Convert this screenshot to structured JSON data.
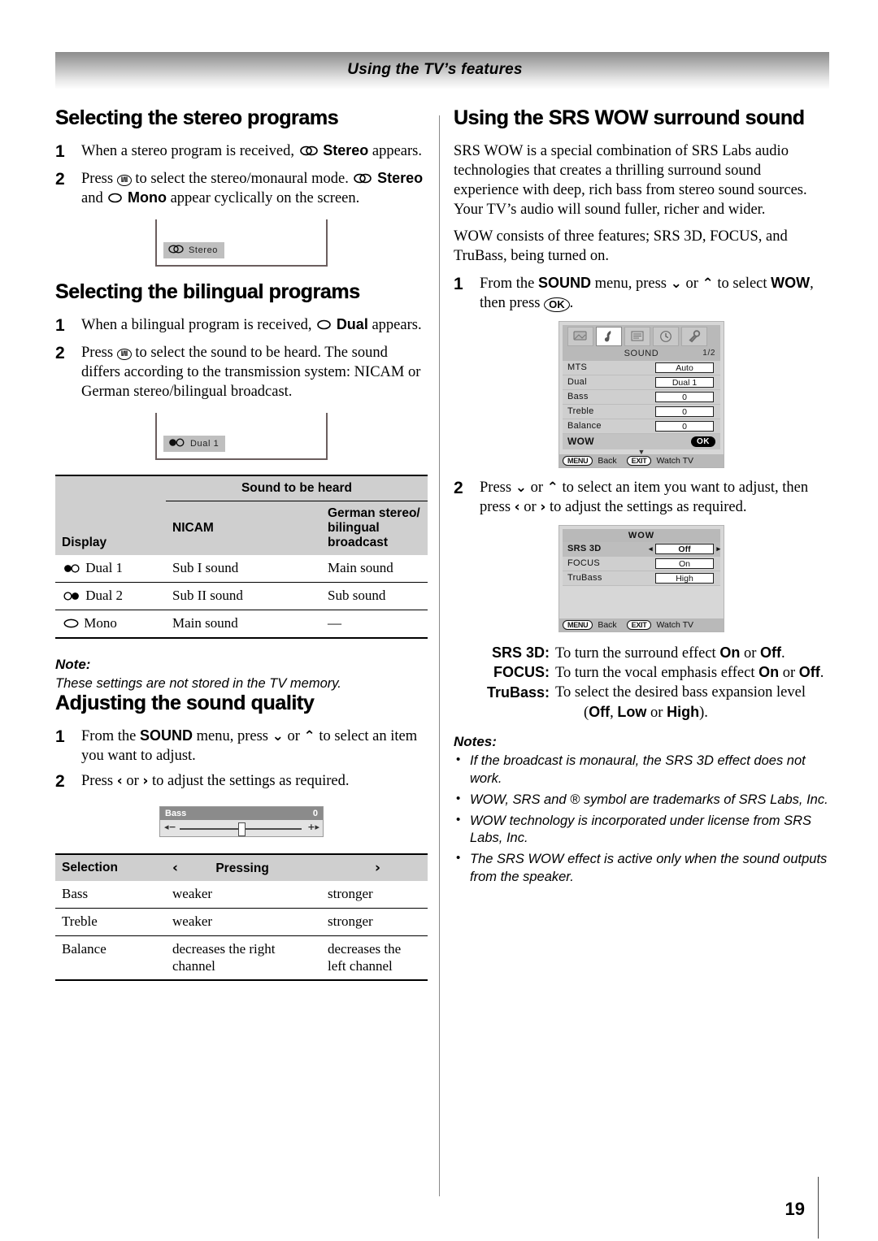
{
  "header": {
    "title": "Using the TV’s features"
  },
  "footer": {
    "page_number": "19"
  },
  "left": {
    "sections": {
      "stereo": {
        "heading": "Selecting the stereo programs",
        "steps": [
          {
            "num": "1",
            "text_a": "When a stereo program is received,",
            "bold": "Stereo",
            "text_b": "appears."
          },
          {
            "num": "2",
            "text_a": "Press",
            "text_b": "to select the stereo/monaural mode.",
            "bold1": "Stereo",
            "mid": "and",
            "bold2": "Mono",
            "text_c": "appear cyclically on the screen."
          }
        ],
        "osd_chip": "Stereo"
      },
      "bilingual": {
        "heading": "Selecting the bilingual programs",
        "steps": [
          {
            "num": "1",
            "text_a": "When a bilingual program is received,",
            "bold": "Dual",
            "text_b": "appears."
          },
          {
            "num": "2",
            "text_a": "Press",
            "text_b": "to select the sound to be heard. The sound differs according to the transmission system: NICAM or German stereo/bilingual broadcast."
          }
        ],
        "osd_chip": "Dual  1"
      },
      "sound_quality": {
        "heading": "Adjusting the sound quality",
        "steps": [
          {
            "num": "1",
            "text_a": "From the",
            "bold": "SOUND",
            "text_b": "menu, press",
            "text_c": "or",
            "text_d": "to select an item you want to adjust."
          },
          {
            "num": "2",
            "text_a": "Press",
            "text_b": "or",
            "text_c": "to adjust the settings as required."
          }
        ],
        "bass_osd": {
          "label": "Bass",
          "value": "0",
          "minus": "−",
          "plus": "+"
        }
      }
    },
    "sound_table": {
      "header_display": "Display",
      "header_group": "Sound to be heard",
      "header_nicam": "NICAM",
      "header_german_l1": "German stereo/",
      "header_german_l2": "bilingual broadcast",
      "rows": [
        {
          "display": "Dual 1",
          "symbol": "dual1",
          "nicam": "Sub I sound",
          "german": "Main sound"
        },
        {
          "display": "Dual 2",
          "symbol": "dual2",
          "nicam": "Sub II sound",
          "german": "Sub sound"
        },
        {
          "display": "Mono",
          "symbol": "mono",
          "nicam": "Main sound",
          "german": "—"
        }
      ]
    },
    "note": {
      "title": "Note:",
      "text": "These settings are not stored in the TV memory."
    },
    "selection_table": {
      "header_selection": "Selection",
      "header_left_arrow": "‹",
      "header_pressing": "Pressing",
      "header_right_arrow": "›",
      "rows": [
        {
          "selection": "Bass",
          "left": "weaker",
          "right": "stronger"
        },
        {
          "selection": "Treble",
          "left": "weaker",
          "right": "stronger"
        },
        {
          "selection": "Balance",
          "left": "decreases the right channel",
          "right": "decreases the left channel"
        }
      ]
    }
  },
  "right": {
    "heading": "Using the SRS WOW surround sound",
    "paragraphs": [
      "SRS WOW is a special combination of SRS Labs audio technologies that creates a thrilling surround sound experience with deep, rich bass from stereo sound sources. Your TV’s audio will sound fuller, richer and wider.",
      "WOW consists of three features; SRS 3D, FOCUS, and TruBass, being turned on."
    ],
    "steps": [
      {
        "num": "1",
        "text_a": "From the",
        "bold": "SOUND",
        "text_b": "menu, press",
        "text_c": "or",
        "text_d": "to select",
        "bold2": "WOW",
        "text_e": ", then press",
        "text_f": "."
      },
      {
        "num": "2",
        "text_a": "Press",
        "text_b": "or",
        "text_c": "to select an item you want to adjust, then press",
        "text_d": "or",
        "text_e": "to adjust the settings as required."
      }
    ],
    "sound_menu": {
      "title": "SOUND",
      "page": "1/2",
      "icons": [
        "picture-icon",
        "sound-icon",
        "features-icon",
        "timer-icon",
        "setup-icon"
      ],
      "selected_icon_index": 1,
      "rows": [
        {
          "label": "MTS",
          "value": "Auto"
        },
        {
          "label": "Dual",
          "value": "Dual 1"
        },
        {
          "label": "Bass",
          "value": "0"
        },
        {
          "label": "Treble",
          "value": "0"
        },
        {
          "label": "Balance",
          "value": "0"
        }
      ],
      "wow_row": {
        "label": "WOW",
        "button": "OK"
      },
      "footer": {
        "menu_key": "MENU",
        "menu_action": "Back",
        "exit_key": "EXIT",
        "exit_action": "Watch TV"
      }
    },
    "wow_menu": {
      "title": "WOW",
      "rows": [
        {
          "label": "SRS 3D",
          "value": "Off",
          "highlighted": true
        },
        {
          "label": "FOCUS",
          "value": "On",
          "highlighted": false
        },
        {
          "label": "TruBass",
          "value": "High",
          "highlighted": false
        }
      ],
      "footer": {
        "menu_key": "MENU",
        "menu_action": "Back",
        "exit_key": "EXIT",
        "exit_action": "Watch TV"
      }
    },
    "srs_descriptions": [
      {
        "name": "SRS 3D:",
        "text_a": "To turn the surround effect",
        "b1": "On",
        "or": "or",
        "b2": "Off",
        "text_b": "."
      },
      {
        "name": "FOCUS:",
        "text_a": "To turn the vocal emphasis effect",
        "b1": "On",
        "or": "or",
        "b2": "Off",
        "text_b": "."
      },
      {
        "name": "TruBass:",
        "text_a": "To select the desired bass expansion level",
        "b1": "",
        "or": "",
        "b2": "",
        "text_b": ""
      }
    ],
    "trubass_values": {
      "open": "(",
      "off": "Off",
      "comma": ", ",
      "low": "Low",
      "or": " or ",
      "high": "High",
      "close": ")."
    },
    "notes": {
      "title": "Notes:",
      "items": [
        "If the broadcast is monaural, the SRS 3D effect does not work.",
        "WOW, SRS and  ® symbol are trademarks of SRS Labs, Inc.",
        "WOW technology is incorporated under license from SRS Labs, Inc.",
        "The SRS WOW effect is active only when the sound outputs from the speaker."
      ]
    }
  },
  "icons": {
    "stereo_symbol": "stereo-icon",
    "mono_symbol": "mono-icon",
    "dual_symbol": "dual-icon",
    "remote_key_sound": "sound-mode-key-icon",
    "remote_key_ok": "ok-key-icon",
    "arrow_down": "⌄",
    "arrow_up": "⌃",
    "arrow_left": "‹",
    "arrow_right": "›"
  }
}
